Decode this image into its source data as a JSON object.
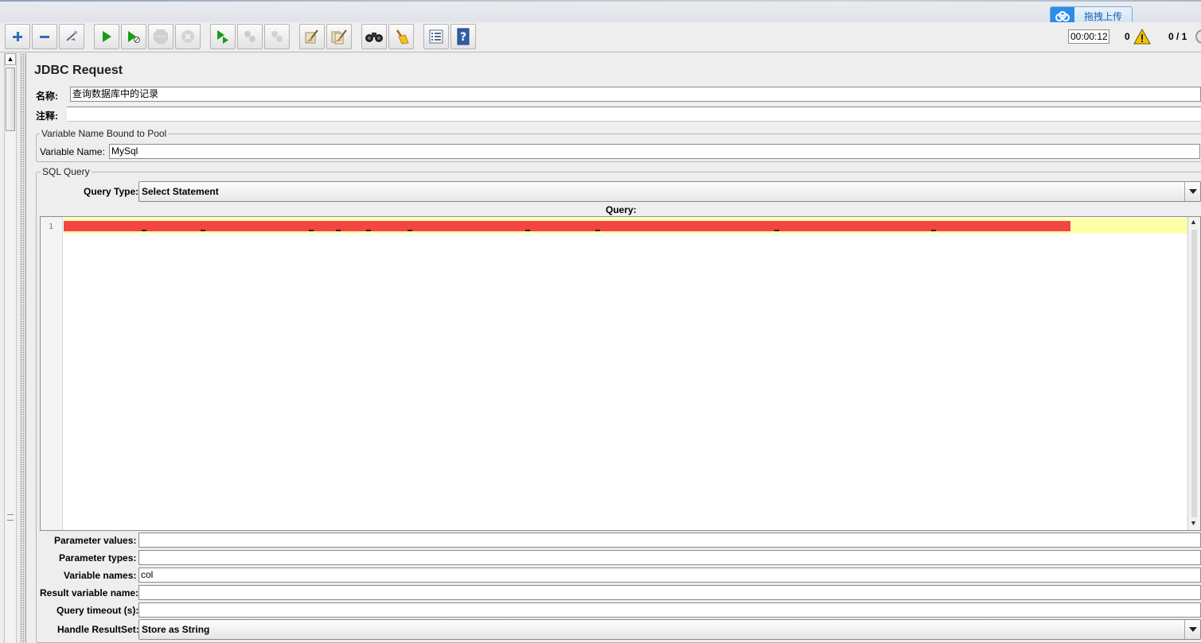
{
  "upload": {
    "label": "拖拽上传"
  },
  "toolbar": {
    "buttons": [
      {
        "name": "add-button",
        "icon": "plus-icon",
        "enabled": true
      },
      {
        "name": "remove-button",
        "icon": "minus-icon",
        "enabled": true
      },
      {
        "name": "toggle-button",
        "icon": "wand-icon",
        "enabled": true
      },
      {
        "name": "start-button",
        "icon": "play-icon",
        "enabled": true
      },
      {
        "name": "start-no-pauses-button",
        "icon": "play-no-pause-icon",
        "enabled": true
      },
      {
        "name": "stop-button",
        "icon": "stop-icon",
        "enabled": false
      },
      {
        "name": "shutdown-button",
        "icon": "shutdown-icon",
        "enabled": false
      },
      {
        "name": "remote-start-button",
        "icon": "remote-play-icon",
        "enabled": true
      },
      {
        "name": "remote-stop-button",
        "icon": "remote-stop-icon",
        "enabled": false
      },
      {
        "name": "remote-shutdown-button",
        "icon": "remote-shutdown-icon",
        "enabled": false
      },
      {
        "name": "clear-button",
        "icon": "broom-icon",
        "enabled": true
      },
      {
        "name": "clear-all-button",
        "icon": "broom-all-icon",
        "enabled": true
      },
      {
        "name": "search-button",
        "icon": "binoculars-icon",
        "enabled": true
      },
      {
        "name": "reset-search-button",
        "icon": "broom-yellow-icon",
        "enabled": true
      },
      {
        "name": "function-helper-button",
        "icon": "list-icon",
        "enabled": true
      },
      {
        "name": "help-button",
        "icon": "help-book-icon",
        "enabled": true
      }
    ],
    "timer": "00:00:12",
    "error_count": "0",
    "threads": "0 / 1"
  },
  "panel": {
    "title": "JDBC Request",
    "name_label": "名称:",
    "name_value": "查询数据库中的记录",
    "comment_label": "注释:",
    "comment_value": "",
    "pool_group": {
      "title": "Variable Name Bound to Pool",
      "variable_label": "Variable Name:",
      "variable_value": "MySql"
    },
    "sql_group": {
      "title": "SQL Query",
      "query_type_label": "Query Type:",
      "query_type_value": "Select Statement",
      "query_label": "Query:",
      "line_number": "1"
    },
    "params": {
      "param_values_label": "Parameter values:",
      "param_values": "",
      "param_types_label": "Parameter types:",
      "param_types": "",
      "var_names_label": "Variable names:",
      "var_names": "col",
      "result_var_label": "Result variable name:",
      "result_var": "",
      "timeout_label": "Query timeout (s):",
      "timeout": "",
      "handle_label": "Handle ResultSet:",
      "handle_value": "Store as String"
    }
  },
  "colors": {
    "redacted": "#f44545",
    "current_line": "#ffffaa",
    "warning": "#f5c400",
    "play": "#1a9a1a"
  }
}
